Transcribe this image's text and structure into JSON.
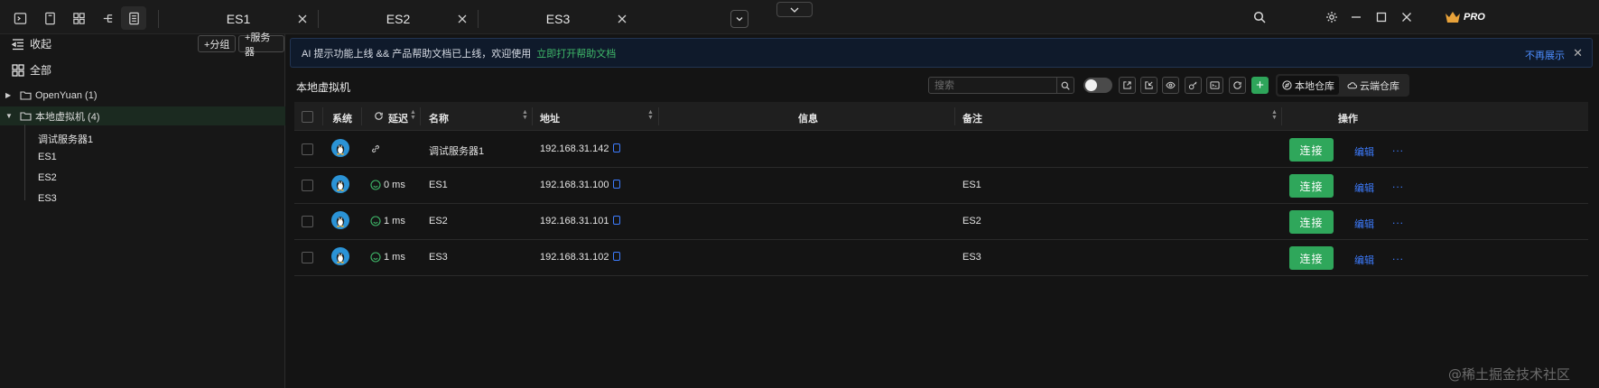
{
  "topbar": {
    "tabs": [
      {
        "label": "ES1"
      },
      {
        "label": "ES2"
      },
      {
        "label": "ES3"
      }
    ],
    "pro_label": "PRO"
  },
  "sidebar": {
    "collapse_label": "收起",
    "all_label": "全部",
    "add_group_label": "+分组",
    "add_server_label": "+服务器",
    "groups": [
      {
        "label": "OpenYuan (1)",
        "expanded": false
      },
      {
        "label": "本地虚拟机 (4)",
        "expanded": true
      }
    ],
    "servers": [
      "调试服务器1",
      "ES1",
      "ES2",
      "ES3"
    ]
  },
  "notice": {
    "text": "AI 提示功能上线 && 产品帮助文档已上线，欢迎使用",
    "link": "立即打开帮助文档",
    "dismiss": "不再展示"
  },
  "main": {
    "title": "本地虚拟机",
    "search_placeholder": "搜索",
    "repo_local": "本地仓库",
    "repo_cloud": "云端仓库"
  },
  "table": {
    "headers": {
      "system": "系统",
      "latency": "延迟",
      "name": "名称",
      "address": "地址",
      "info": "信息",
      "remark": "备注",
      "actions": "操作"
    },
    "rows": [
      {
        "latency": "",
        "name": "调试服务器1",
        "address": "192.168.31.142",
        "info": "",
        "remark": ""
      },
      {
        "latency": "0 ms",
        "name": "ES1",
        "address": "192.168.31.100",
        "info": "",
        "remark": "ES1"
      },
      {
        "latency": "1 ms",
        "name": "ES2",
        "address": "192.168.31.101",
        "info": "",
        "remark": "ES2"
      },
      {
        "latency": "1 ms",
        "name": "ES3",
        "address": "192.168.31.102",
        "info": "",
        "remark": "ES3"
      }
    ],
    "connect_label": "连接",
    "edit_label": "编辑",
    "more_label": "..."
  },
  "watermark": "@稀土掘金技术社区",
  "colors": {
    "accent_green": "#2fa75b",
    "link_blue": "#3d7cff",
    "background": "#141414"
  },
  "icons": [
    "terminal-icon",
    "document-icon",
    "grid-icon",
    "tree-icon",
    "list-icon",
    "close-icon",
    "chevron-down-icon",
    "search-icon",
    "crown-icon",
    "gear-icon",
    "minimize-icon",
    "maximize-icon",
    "window-close-icon",
    "folder-icon",
    "linux-icon",
    "refresh-icon",
    "copy-icon"
  ]
}
